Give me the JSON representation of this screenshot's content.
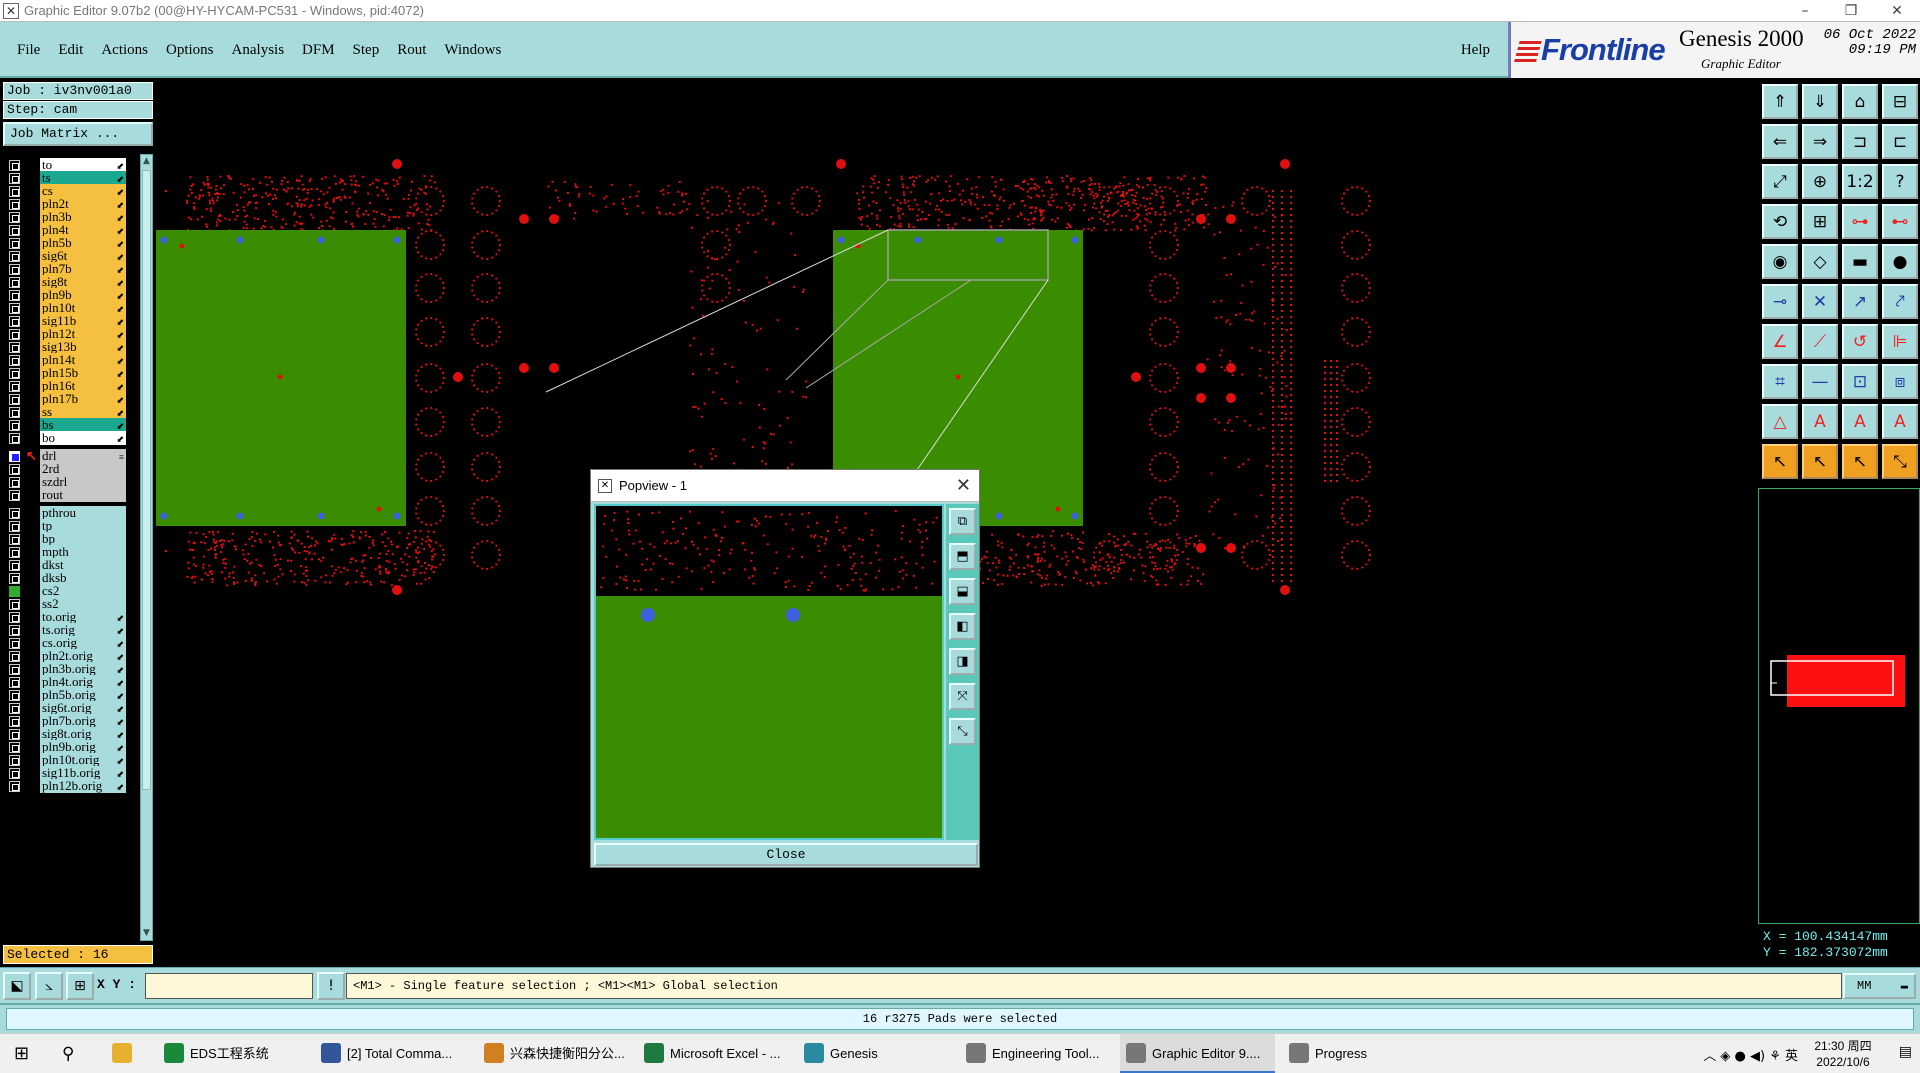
{
  "window": {
    "title": "Graphic Editor 9.07b2 (00@HY-HYCAM-PC531 - Windows, pid:4072)",
    "controls": [
      "–",
      "❐",
      "✕"
    ]
  },
  "menu": {
    "items": [
      "File",
      "Edit",
      "Actions",
      "Options",
      "Analysis",
      "DFM",
      "Step",
      "Rout",
      "Windows"
    ],
    "help": "Help"
  },
  "brand": {
    "logo": "Frontline",
    "product": "Genesis 2000",
    "subtitle": "Graphic Editor",
    "date": "06 Oct 2022",
    "time": "09:19 PM"
  },
  "job": {
    "job_label": "Job  : iv3nv001a0",
    "step_label": "Step: cam",
    "matrix_button": "Job Matrix ..."
  },
  "layers": [
    {
      "name": "to",
      "color": "#ffffff",
      "tag": "⬋"
    },
    {
      "name": "ts",
      "color": "#1aa890",
      "tag": "⬋"
    },
    {
      "name": "cs",
      "color": "#f5c040",
      "tag": "⬋"
    },
    {
      "name": "pln2t",
      "color": "#f5c040",
      "tag": "⬋"
    },
    {
      "name": "pln3b",
      "color": "#f5c040",
      "tag": "⬋"
    },
    {
      "name": "pln4t",
      "color": "#f5c040",
      "tag": "⬋"
    },
    {
      "name": "pln5b",
      "color": "#f5c040",
      "tag": "⬋"
    },
    {
      "name": "sig6t",
      "color": "#f5c040",
      "tag": "⬋"
    },
    {
      "name": "pln7b",
      "color": "#f5c040",
      "tag": "⬋"
    },
    {
      "name": "sig8t",
      "color": "#f5c040",
      "tag": "⬋"
    },
    {
      "name": "pln9b",
      "color": "#f5c040",
      "tag": "⬋"
    },
    {
      "name": "pln10t",
      "color": "#f5c040",
      "tag": "⬋"
    },
    {
      "name": "sig11b",
      "color": "#f5c040",
      "tag": "⬋"
    },
    {
      "name": "pln12t",
      "color": "#f5c040",
      "tag": "⬋"
    },
    {
      "name": "sig13b",
      "color": "#f5c040",
      "tag": "⬋"
    },
    {
      "name": "pln14t",
      "color": "#f5c040",
      "tag": "⬋"
    },
    {
      "name": "pln15b",
      "color": "#f5c040",
      "tag": "⬋"
    },
    {
      "name": "pln16t",
      "color": "#f5c040",
      "tag": "⬋"
    },
    {
      "name": "pln17b",
      "color": "#f5c040",
      "tag": "⬋"
    },
    {
      "name": "ss",
      "color": "#f5c040",
      "tag": "⬋"
    },
    {
      "name": "bs",
      "color": "#1aa890",
      "tag": "⬋"
    },
    {
      "name": "bo",
      "color": "#ffffff",
      "tag": "⬋"
    },
    {
      "name": "drl",
      "color": "#c8c8c8",
      "tag": "≡",
      "gap": true,
      "active": true
    },
    {
      "name": "2rd",
      "color": "#c8c8c8",
      "tag": ""
    },
    {
      "name": "szdrl",
      "color": "#c8c8c8",
      "tag": ""
    },
    {
      "name": "rout",
      "color": "#c8c8c8",
      "tag": ""
    },
    {
      "name": "pthrou",
      "color": "#a8dcdc",
      "tag": "",
      "gap": true
    },
    {
      "name": "tp",
      "color": "#a8dcdc",
      "tag": ""
    },
    {
      "name": "bp",
      "color": "#a8dcdc",
      "tag": ""
    },
    {
      "name": "mpth",
      "color": "#a8dcdc",
      "tag": ""
    },
    {
      "name": "dkst",
      "color": "#a8dcdc",
      "tag": ""
    },
    {
      "name": "dksb",
      "color": "#a8dcdc",
      "tag": ""
    },
    {
      "name": "cs2",
      "color": "#a8dcdc",
      "tag": "",
      "green": true
    },
    {
      "name": "ss2",
      "color": "#a8dcdc",
      "tag": ""
    },
    {
      "name": "to.orig",
      "color": "#a8dcdc",
      "tag": "⬋"
    },
    {
      "name": "ts.orig",
      "color": "#a8dcdc",
      "tag": "⬋"
    },
    {
      "name": "cs.orig",
      "color": "#a8dcdc",
      "tag": "⬋"
    },
    {
      "name": "pln2t.orig",
      "color": "#a8dcdc",
      "tag": "⬋"
    },
    {
      "name": "pln3b.orig",
      "color": "#a8dcdc",
      "tag": "⬋"
    },
    {
      "name": "pln4t.orig",
      "color": "#a8dcdc",
      "tag": "⬋"
    },
    {
      "name": "pln5b.orig",
      "color": "#a8dcdc",
      "tag": "⬋"
    },
    {
      "name": "sig6t.orig",
      "color": "#a8dcdc",
      "tag": "⬋"
    },
    {
      "name": "pln7b.orig",
      "color": "#a8dcdc",
      "tag": "⬋"
    },
    {
      "name": "sig8t.orig",
      "color": "#a8dcdc",
      "tag": "⬋"
    },
    {
      "name": "pln9b.orig",
      "color": "#a8dcdc",
      "tag": "⬋"
    },
    {
      "name": "pln10t.orig",
      "color": "#a8dcdc",
      "tag": "⬋"
    },
    {
      "name": "sig11b.orig",
      "color": "#a8dcdc",
      "tag": "⬋"
    },
    {
      "name": "pln12b.orig",
      "color": "#a8dcdc",
      "tag": "⬋"
    }
  ],
  "selected": "Selected : 16",
  "coords": {
    "x": "X  = 100.434147mm",
    "y": "Y  = 182.373072mm"
  },
  "command": {
    "xy_label": "X Y :",
    "xy_value": "",
    "hint": "<M1> - Single feature selection ; <M1><M1> Global selection",
    "units": "MM"
  },
  "status": "16 r3275 Pads were selected",
  "popview": {
    "title": "Popview - 1",
    "close": "Close"
  },
  "taskbar": {
    "items": [
      {
        "label": "EDS工程系统",
        "color": "#1a8a3a"
      },
      {
        "label": "[2] Total Comma...",
        "color": "#335599"
      },
      {
        "label": "兴森快捷衡阳分公...",
        "color": "#d08020"
      },
      {
        "label": "Microsoft Excel - ...",
        "color": "#1e7a40"
      },
      {
        "label": "Genesis",
        "color": "#2a8aa0"
      },
      {
        "label": "Engineering Tool...",
        "color": "#777777"
      },
      {
        "label": "Graphic Editor 9....",
        "color": "#777777",
        "active": true
      },
      {
        "label": "Progress",
        "color": "#777777"
      }
    ],
    "tray_lang": "英",
    "clock_time": "21:30 周四",
    "clock_date": "2022/10/6"
  },
  "colors": {
    "panel": "#a8dcdc",
    "board_fill": "#3a8c00",
    "pad_red": "#e01010",
    "pad_blue": "#4060e0"
  }
}
